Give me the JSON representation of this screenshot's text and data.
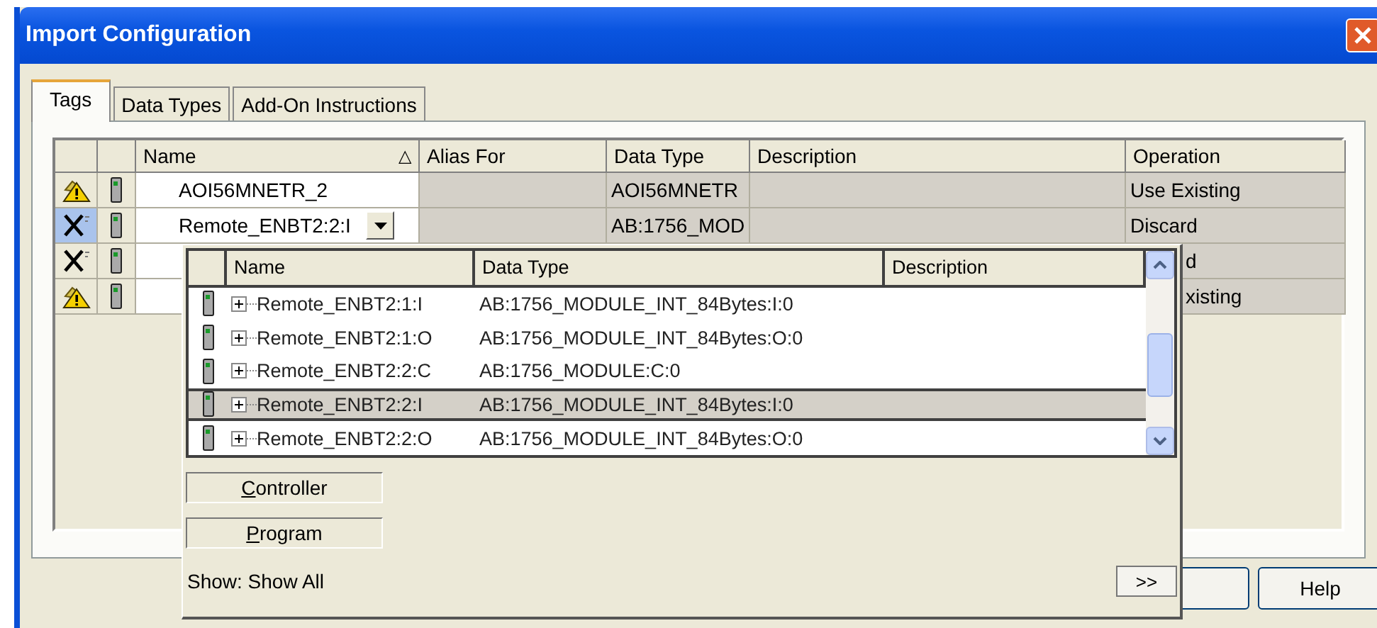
{
  "window": {
    "title": "Import Configuration"
  },
  "tabs": [
    {
      "label": "Tags",
      "selected": true
    },
    {
      "label": "Data Types",
      "selected": false
    },
    {
      "label": "Add-On Instructions",
      "selected": false
    }
  ],
  "table": {
    "columns": [
      {
        "label": "Name",
        "sort_indicator": "△"
      },
      {
        "label": "Alias For"
      },
      {
        "label": "Data Type"
      },
      {
        "label": "Description"
      },
      {
        "label": "Operation"
      }
    ],
    "rows": [
      {
        "kind": "warning",
        "selected": false,
        "dropdown": false,
        "name": "AOI56MNETR_2",
        "data_type": "AOI56MNETR",
        "operation": "Use Existing"
      },
      {
        "kind": "discard",
        "selected": true,
        "dropdown": true,
        "name": "Remote_ENBT2:2:I",
        "data_type": "AB:1756_MOD",
        "operation": "Discard"
      },
      {
        "kind": "discard",
        "selected": false,
        "operation": "d"
      },
      {
        "kind": "warning",
        "selected": false,
        "operation": "xisting"
      }
    ]
  },
  "tag_browser": {
    "columns": [
      "Name",
      "Data Type",
      "Description"
    ],
    "rows": [
      {
        "name": "Remote_ENBT2:1:I",
        "data_type": "AB:1756_MODULE_INT_84Bytes:I:0",
        "selected": false
      },
      {
        "name": "Remote_ENBT2:1:O",
        "data_type": "AB:1756_MODULE_INT_84Bytes:O:0",
        "selected": false
      },
      {
        "name": "Remote_ENBT2:2:C",
        "data_type": "AB:1756_MODULE:C:0",
        "selected": false
      },
      {
        "name": "Remote_ENBT2:2:I",
        "data_type": "AB:1756_MODULE_INT_84Bytes:I:0",
        "selected": true
      },
      {
        "name": "Remote_ENBT2:2:O",
        "data_type": "AB:1756_MODULE_INT_84Bytes:O:0",
        "selected": false
      }
    ],
    "scopes": [
      "Controller",
      "Program"
    ],
    "show": "Show: Show All",
    "more_button": ">>"
  },
  "buttons": [
    "Help"
  ]
}
